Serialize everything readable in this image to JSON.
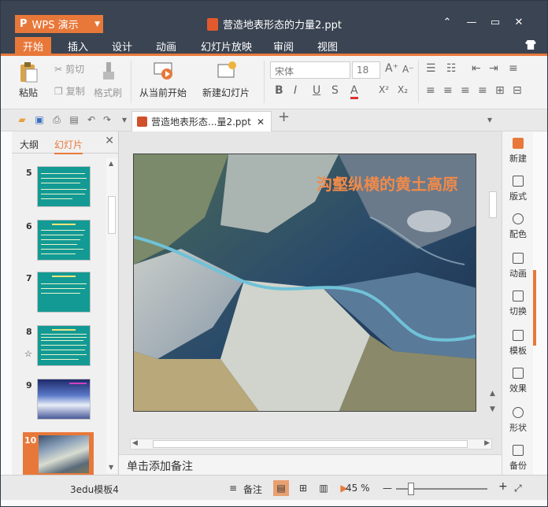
{
  "app": {
    "name": "WPS 演示",
    "document_title": "营造地表形态的力量2.ppt"
  },
  "ribbon_tabs": [
    "开始",
    "插入",
    "设计",
    "动画",
    "幻灯片放映",
    "审阅",
    "视图"
  ],
  "ribbon": {
    "paste": "粘贴",
    "cut": "剪切",
    "copy": "复制",
    "format_painter": "格式刷",
    "from_current": "从当前开始",
    "new_slide": "新建幻灯片",
    "font_name": "宋体",
    "font_size": "18"
  },
  "doc_tab": {
    "label": "营造地表形态...量2.ppt"
  },
  "left_panel": {
    "tab_outline": "大纲",
    "tab_slides": "幻灯片",
    "slides": [
      {
        "num": "5"
      },
      {
        "num": "6"
      },
      {
        "num": "7"
      },
      {
        "num": "8"
      },
      {
        "num": "9"
      },
      {
        "num": "10",
        "selected": true
      }
    ]
  },
  "slide": {
    "title": "沟壑纵横的黄土高原"
  },
  "notes_placeholder": "单击添加备注",
  "sidebar_items": [
    "新建",
    "版式",
    "配色",
    "动画",
    "切换",
    "模板",
    "效果",
    "形状",
    "备份"
  ],
  "status": {
    "template": "3edu模板4",
    "notes": "备注",
    "zoom": "45 %"
  },
  "colors": {
    "accent": "#e8783a",
    "titlebar": "#3a4452",
    "thumb_bg": "#139a94"
  }
}
